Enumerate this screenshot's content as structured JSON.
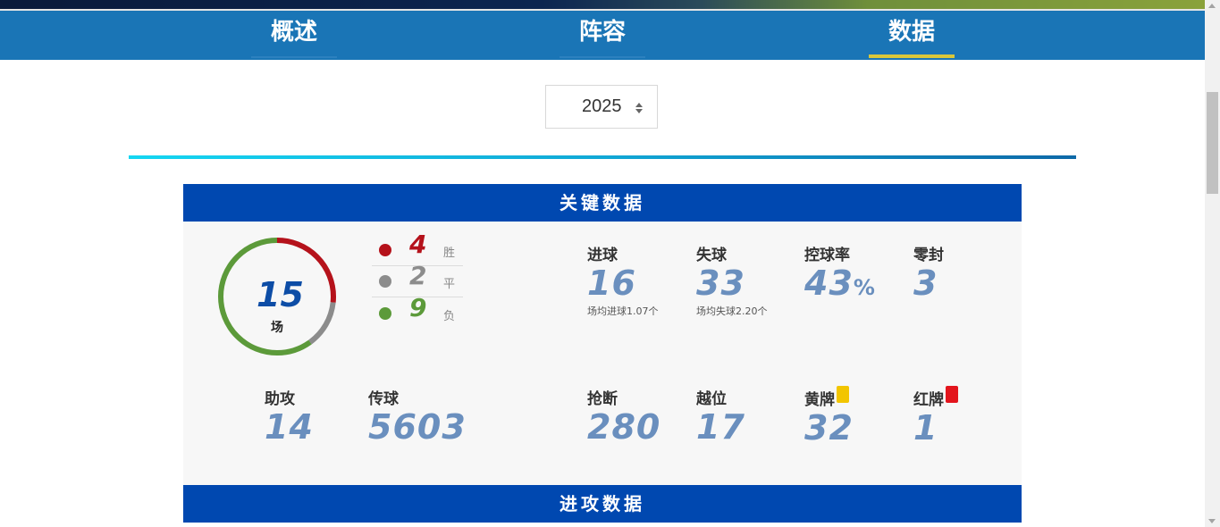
{
  "nav": {
    "tabs": [
      {
        "label": "概述"
      },
      {
        "label": "阵容"
      },
      {
        "label": "数据"
      }
    ],
    "active_index": 2
  },
  "year_select": {
    "value": "2025"
  },
  "sections": {
    "key_stats_title": "关键数据",
    "attack_stats_title": "进攻数据"
  },
  "matches": {
    "total": "15",
    "unit": "场",
    "record": [
      {
        "count": "4",
        "label": "胜",
        "color": "#b5121b"
      },
      {
        "count": "2",
        "label": "平",
        "color": "#8c8c8c"
      },
      {
        "count": "9",
        "label": "负",
        "color": "#5c9a3a"
      }
    ]
  },
  "stats": {
    "goals": {
      "label": "进球",
      "value": "16",
      "sub": "场均进球1.07个"
    },
    "conceded": {
      "label": "失球",
      "value": "33",
      "sub": "场均失球2.20个"
    },
    "possession": {
      "label": "控球率",
      "value": "43",
      "unit": "%"
    },
    "clean_sheets": {
      "label": "零封",
      "value": "3"
    },
    "assists": {
      "label": "助攻",
      "value": "14"
    },
    "passes": {
      "label": "传球",
      "value": "5603"
    },
    "tackles": {
      "label": "抢断",
      "value": "280"
    },
    "offsides": {
      "label": "越位",
      "value": "17"
    },
    "yellow_cards": {
      "label": "黄牌",
      "value": "32"
    },
    "red_cards": {
      "label": "红牌",
      "value": "1"
    }
  },
  "colors": {
    "nav_bg": "#1a75b6",
    "active_underline": "#d9c73a",
    "section_header_bg": "#0048b0",
    "stat_value": "#6a8fbe"
  }
}
